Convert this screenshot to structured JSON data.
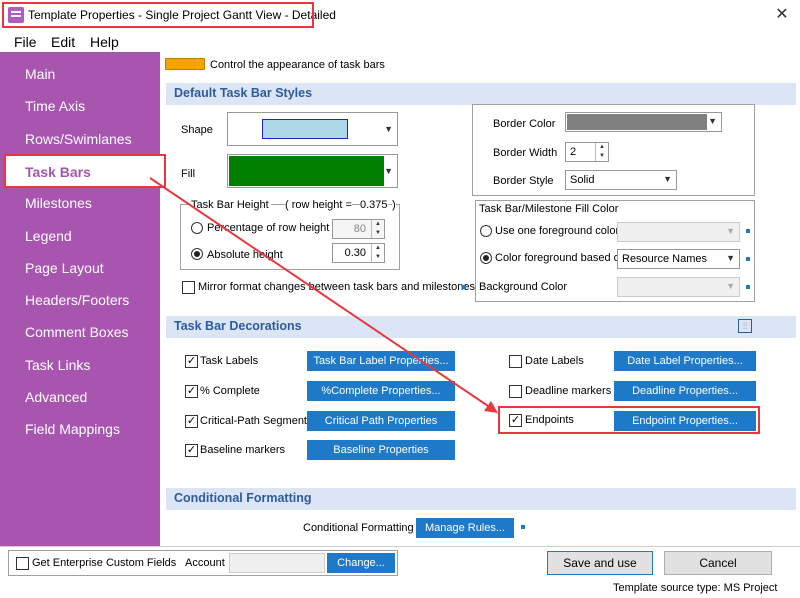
{
  "window": {
    "title": "Template Properties - Single Project Gantt View - Detailed",
    "close": "✕"
  },
  "menu": [
    "File",
    "Edit",
    "Help"
  ],
  "sidebar": {
    "items": [
      "Main",
      "Time Axis",
      "Rows/Swimlanes",
      "Task Bars",
      "Milestones",
      "Legend",
      "Page Layout",
      "Headers/Footers",
      "Comment Boxes",
      "Task Links",
      "Advanced",
      "Field Mappings"
    ],
    "selected": "Task Bars"
  },
  "info": {
    "text": "Control the appearance of task bars",
    "swatch_color": "#f5a300"
  },
  "default_styles": {
    "header": "Default Task Bar Styles",
    "shape_label": "Shape",
    "shape_color": "#add8e6",
    "fill_label": "Fill",
    "fill_color": "#008000",
    "height_group": "Task Bar Height",
    "row_height_text": "( row height =",
    "row_height_value": "0.375",
    "row_height_close": ")",
    "pct_label": "Percentage of row height",
    "pct_value": "80",
    "abs_label": "Absolute height",
    "abs_value": "0.30",
    "mirror_label": "Mirror format changes between task bars and milestones",
    "border_color_label": "Border Color",
    "border_color": "#808080",
    "border_width_label": "Border Width",
    "border_width_value": "2",
    "border_style_label": "Border Style",
    "border_style_value": "Solid",
    "fill_group": "Task Bar/Milestone Fill Color",
    "use_one_label": "Use one foreground color:",
    "color_fg_label": "Color foreground based on",
    "color_fg_value": "Resource Names",
    "bg_color_label": "Background Color"
  },
  "decorations": {
    "header": "Task Bar Decorations",
    "left": [
      {
        "check": "Task Labels",
        "button": "Task Bar Label Properties..."
      },
      {
        "check": "% Complete",
        "button": "%Complete Properties..."
      },
      {
        "check": "Critical-Path Segments",
        "button": "Critical Path Properties"
      },
      {
        "check": "Baseline markers",
        "button": "Baseline Properties"
      }
    ],
    "right": [
      {
        "check": "Date Labels",
        "button": "Date Label Properties..."
      },
      {
        "check": "Deadline markers",
        "button": "Deadline Properties..."
      },
      {
        "check": "Endpoints",
        "button": "Endpoint Properties..."
      }
    ],
    "checkmark": "✓"
  },
  "conditional": {
    "header": "Conditional Formatting",
    "label": "Conditional Formatting",
    "button": "Manage Rules..."
  },
  "footer": {
    "enterprise_label": "Get Enterprise Custom Fields",
    "account_label": "Account",
    "change_button": "Change...",
    "save_button": "Save and use",
    "cancel_button": "Cancel",
    "source_text": "Template source type: MS Project"
  },
  "colors": {
    "accent": "#a855b0",
    "highlight": "#e8373f",
    "button": "#1e7ac9"
  }
}
